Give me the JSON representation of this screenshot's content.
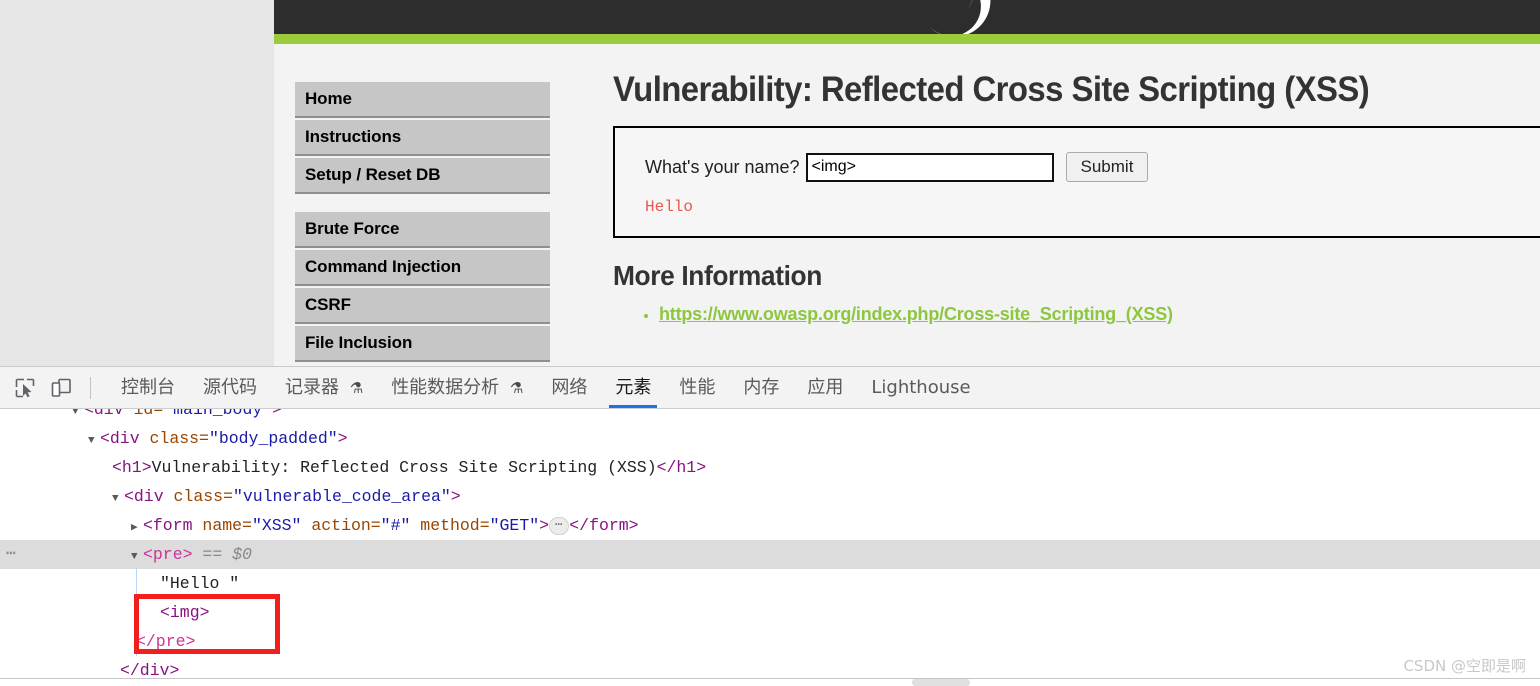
{
  "browser_page": {
    "header": {
      "logo_icon": "dvwa-swirl-logo",
      "accent_color": "#9acc3b",
      "bar_color": "#2d2d2d"
    },
    "nav_groups": [
      {
        "items": [
          "Home",
          "Instructions",
          "Setup / Reset DB"
        ]
      },
      {
        "items": [
          "Brute Force",
          "Command Injection",
          "CSRF",
          "File Inclusion"
        ]
      }
    ],
    "page_title": "Vulnerability: Reflected Cross Site Scripting (XSS)",
    "form": {
      "label": "What's your name?",
      "input_value": "<img>",
      "input_placeholder": "",
      "submit_label": "Submit",
      "output_text": "Hello"
    },
    "more_information": {
      "heading": "More Information",
      "links": [
        "https://www.owasp.org/index.php/Cross-site_Scripting_(XSS)"
      ],
      "link_color": "#8dc63f"
    }
  },
  "devtools": {
    "icons": {
      "inspect": "inspect-element-icon",
      "device": "device-toolbar-icon"
    },
    "tabs": [
      {
        "label": "控制台",
        "active": false,
        "warn": false
      },
      {
        "label": "源代码",
        "active": false,
        "warn": false
      },
      {
        "label": "记录器",
        "active": false,
        "warn": true
      },
      {
        "label": "性能数据分析",
        "active": false,
        "warn": true
      },
      {
        "label": "网络",
        "active": false,
        "warn": false
      },
      {
        "label": "元素",
        "active": true,
        "warn": false
      },
      {
        "label": "性能",
        "active": false,
        "warn": false
      },
      {
        "label": "内存",
        "active": false,
        "warn": false
      },
      {
        "label": "应用",
        "active": false,
        "warn": false
      },
      {
        "label": "Lighthouse",
        "active": false,
        "warn": false
      }
    ],
    "active_tab": "元素",
    "dom_rows": [
      {
        "id": "row-main-body",
        "indent": 72,
        "clipped": true,
        "parts": [
          {
            "t": "twisty",
            "v": "▼"
          },
          {
            "t": "tag",
            "v": "<div "
          },
          {
            "t": "attr-name",
            "v": "id="
          },
          {
            "t": "attr-val",
            "v": "\"main_body\""
          },
          {
            "t": "tag",
            "v": ">"
          }
        ]
      },
      {
        "id": "row-body-padded",
        "indent": 88,
        "parts": [
          {
            "t": "twisty",
            "v": "▼"
          },
          {
            "t": "tag",
            "v": "<div "
          },
          {
            "t": "attr-name",
            "v": "class="
          },
          {
            "t": "attr-val",
            "v": "\"body_padded\""
          },
          {
            "t": "tag",
            "v": ">"
          }
        ]
      },
      {
        "id": "row-h1",
        "indent": 112,
        "parts": [
          {
            "t": "tag",
            "v": "<h1>"
          },
          {
            "t": "txt",
            "v": "Vulnerability: Reflected Cross Site Scripting (XSS)"
          },
          {
            "t": "tag",
            "v": "</h1>"
          }
        ]
      },
      {
        "id": "row-vuln-code-area",
        "indent": 112,
        "parts": [
          {
            "t": "twisty",
            "v": "▼"
          },
          {
            "t": "tag",
            "v": "<div "
          },
          {
            "t": "attr-name",
            "v": "class="
          },
          {
            "t": "attr-val",
            "v": "\"vulnerable_code_area\""
          },
          {
            "t": "tag",
            "v": ">"
          }
        ]
      },
      {
        "id": "row-form",
        "indent": 131,
        "parts": [
          {
            "t": "twisty",
            "v": "▶"
          },
          {
            "t": "tag",
            "v": "<form "
          },
          {
            "t": "attr-name",
            "v": "name="
          },
          {
            "t": "attr-val",
            "v": "\"XSS\""
          },
          {
            "t": "tag",
            "v": " "
          },
          {
            "t": "attr-name",
            "v": "action="
          },
          {
            "t": "attr-val",
            "v": "\"#\""
          },
          {
            "t": "tag",
            "v": " "
          },
          {
            "t": "attr-name",
            "v": "method="
          },
          {
            "t": "attr-val",
            "v": "\"GET\""
          },
          {
            "t": "tag",
            "v": ">"
          },
          {
            "t": "badge",
            "v": "⋯"
          },
          {
            "t": "tag",
            "v": "</form>"
          }
        ]
      },
      {
        "id": "row-pre",
        "indent": 131,
        "selected": true,
        "dots": "⋯",
        "parts": [
          {
            "t": "twisty",
            "v": "▼"
          },
          {
            "t": "pre-tag",
            "v": "<pre>"
          },
          {
            "t": "dollar",
            "v": " == $0"
          }
        ]
      },
      {
        "id": "row-hello-text",
        "indent": 160,
        "parts": [
          {
            "t": "txt",
            "v": "\"Hello \""
          }
        ]
      },
      {
        "id": "row-img",
        "indent": 160,
        "parts": [
          {
            "t": "tag",
            "v": "<img>"
          }
        ]
      },
      {
        "id": "row-pre-close",
        "indent": 136,
        "parts": [
          {
            "t": "pre-tag",
            "v": "</pre>"
          }
        ]
      },
      {
        "id": "row-div-close",
        "indent": 120,
        "parts": [
          {
            "t": "tag",
            "v": "</div>"
          }
        ]
      }
    ],
    "highlight_box_color": "#f21f1f"
  },
  "watermark": "CSDN @空即是啊"
}
